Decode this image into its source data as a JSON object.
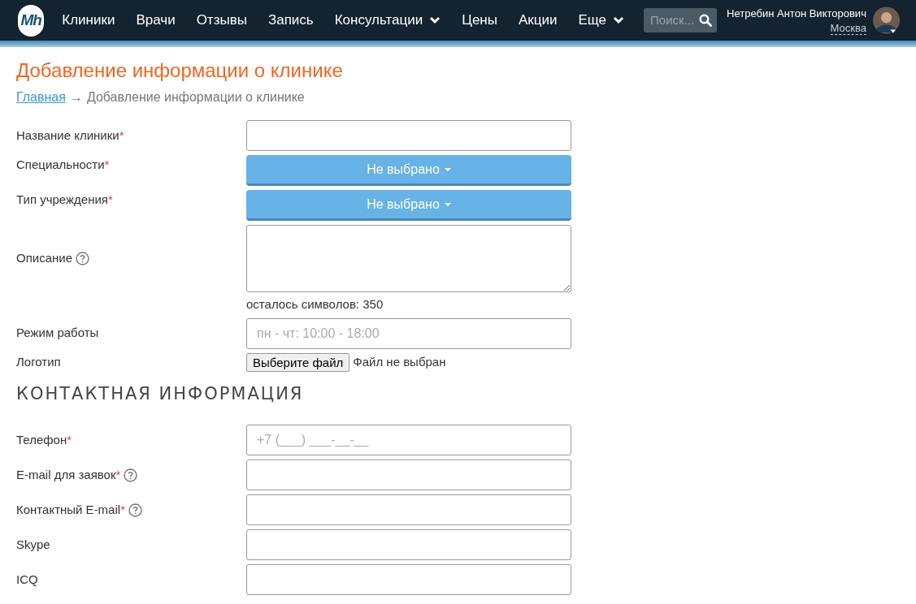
{
  "header": {
    "logo": "Mh",
    "nav": [
      {
        "label": "Клиники",
        "has_dropdown": false
      },
      {
        "label": "Врачи",
        "has_dropdown": false
      },
      {
        "label": "Отзывы",
        "has_dropdown": false
      },
      {
        "label": "Запись",
        "has_dropdown": false
      },
      {
        "label": "Консультации",
        "has_dropdown": true
      },
      {
        "label": "Цены",
        "has_dropdown": false
      },
      {
        "label": "Акции",
        "has_dropdown": false
      },
      {
        "label": "Еще",
        "has_dropdown": true
      }
    ],
    "search": {
      "placeholder": "Поиск..."
    },
    "user": {
      "name": "Нетребин Антон Викторович",
      "city": "Москва"
    }
  },
  "required_mark": "*",
  "page": {
    "title": "Добавление информации о клинике",
    "breadcrumb": {
      "home": "Главная",
      "separator": "→",
      "current": "Добавление информации о клинике"
    }
  },
  "form": [
    {
      "kind": "text",
      "label": "Название клиники",
      "required": true,
      "help": false
    },
    {
      "kind": "dropdown",
      "label": "Специальности",
      "required": true,
      "help": false,
      "value": "Не выбрано"
    },
    {
      "kind": "dropdown",
      "label": "Тип учреждения",
      "required": true,
      "help": false,
      "value": "Не выбрано"
    },
    {
      "kind": "textarea",
      "label": "Описание",
      "required": false,
      "help": true,
      "counter": "осталось символов: 350"
    },
    {
      "kind": "text",
      "label": "Режим работы",
      "required": false,
      "help": false,
      "placeholder": "пн - чт: 10:00 - 18:00"
    },
    {
      "kind": "file",
      "label": "Логотип",
      "required": false,
      "help": false,
      "button": "Выберите файл",
      "status": "Файл не выбран"
    }
  ],
  "contact_section": {
    "heading": "КОНТАКТНАЯ ИНФОРМАЦИЯ",
    "fields": [
      {
        "kind": "text",
        "label": "Телефон",
        "required": true,
        "help": false,
        "placeholder": "+7 (___) ___-__-__"
      },
      {
        "kind": "text",
        "label": "E-mail для заявок",
        "required": true,
        "help": true
      },
      {
        "kind": "text",
        "label": "Контактный E-mail",
        "required": true,
        "help": true
      },
      {
        "kind": "text",
        "label": "Skype",
        "required": false,
        "help": false
      },
      {
        "kind": "text",
        "label": "ICQ",
        "required": false,
        "help": false
      }
    ]
  }
}
